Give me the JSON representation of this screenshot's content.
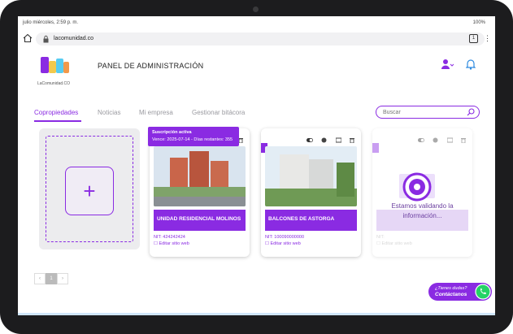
{
  "status": {
    "time": "julio miércoles, 2:59 p. m.",
    "battery": "100%"
  },
  "browser": {
    "url": "lacomunidad.co",
    "tab_count": "1",
    "menu": "⋮"
  },
  "brand": {
    "logo_text": "LaComunidad.CO",
    "panel_title": "PANEL DE ADMINISTRACIÓN"
  },
  "nav": {
    "tabs": [
      {
        "label": "Copropiedades"
      },
      {
        "label": "Noticias"
      },
      {
        "label": "Mi empresa"
      },
      {
        "label": "Gestionar bitácora"
      }
    ]
  },
  "search": {
    "placeholder": "Buscar"
  },
  "add_card": {
    "symbol": "+"
  },
  "cards": [
    {
      "name": "UNIDAD RESIDENCIAL MOLINOS",
      "nit": "NIT: 424242424",
      "edit": "Editar sitio web",
      "badge": {
        "line1": "Suscripción activa",
        "line2": "Vence: 2025-07-14 - Días restantes: 355"
      }
    },
    {
      "name": "BALCONES DE ASTORGA",
      "nit": "NIT: 100090000000",
      "edit": "Editar sitio web"
    },
    {
      "nit": "NIT:",
      "edit": "Editar sitio web",
      "status": "Estamos validando la información..."
    }
  ],
  "pagination": {
    "prev": "‹",
    "current": "1",
    "next": "›"
  },
  "contact": {
    "line1": "¿Tienes dudas?",
    "line2": "Contáctanos"
  },
  "colors": {
    "accent": "#8a2be2",
    "whatsapp": "#25d366"
  }
}
